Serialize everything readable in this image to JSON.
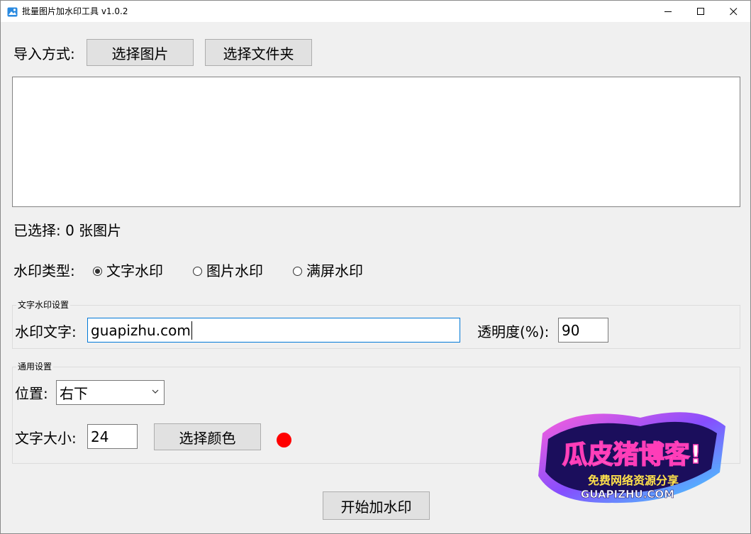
{
  "window": {
    "title": "批量图片加水印工具 v1.0.2"
  },
  "import": {
    "label": "导入方式:",
    "select_images": "选择图片",
    "select_folder": "选择文件夹"
  },
  "selection": {
    "count_text": "已选择: 0 张图片"
  },
  "watermark_type": {
    "label": "水印类型:",
    "options": [
      {
        "label": "文字水印",
        "checked": true
      },
      {
        "label": "图片水印",
        "checked": false
      },
      {
        "label": "满屏水印",
        "checked": false
      }
    ]
  },
  "text_settings": {
    "group_title": "文字水印设置",
    "text_label": "水印文字:",
    "text_value": "guapizhu.com",
    "opacity_label": "透明度(%):",
    "opacity_value": "90"
  },
  "general_settings": {
    "group_title": "通用设置",
    "position_label": "位置:",
    "position_value": "右下",
    "size_label": "文字大小:",
    "size_value": "24",
    "color_button": "选择颜色",
    "color_value": "#ff0000"
  },
  "actions": {
    "start": "开始加水印"
  },
  "logo": {
    "line1": "瓜皮猪博客!",
    "line2": "免费网络资源分享",
    "line3": "GUAPIZHU.COM"
  },
  "colors": {
    "accent": "#0078d7",
    "background": "#f0f0f0",
    "button": "#e1e1e1"
  }
}
